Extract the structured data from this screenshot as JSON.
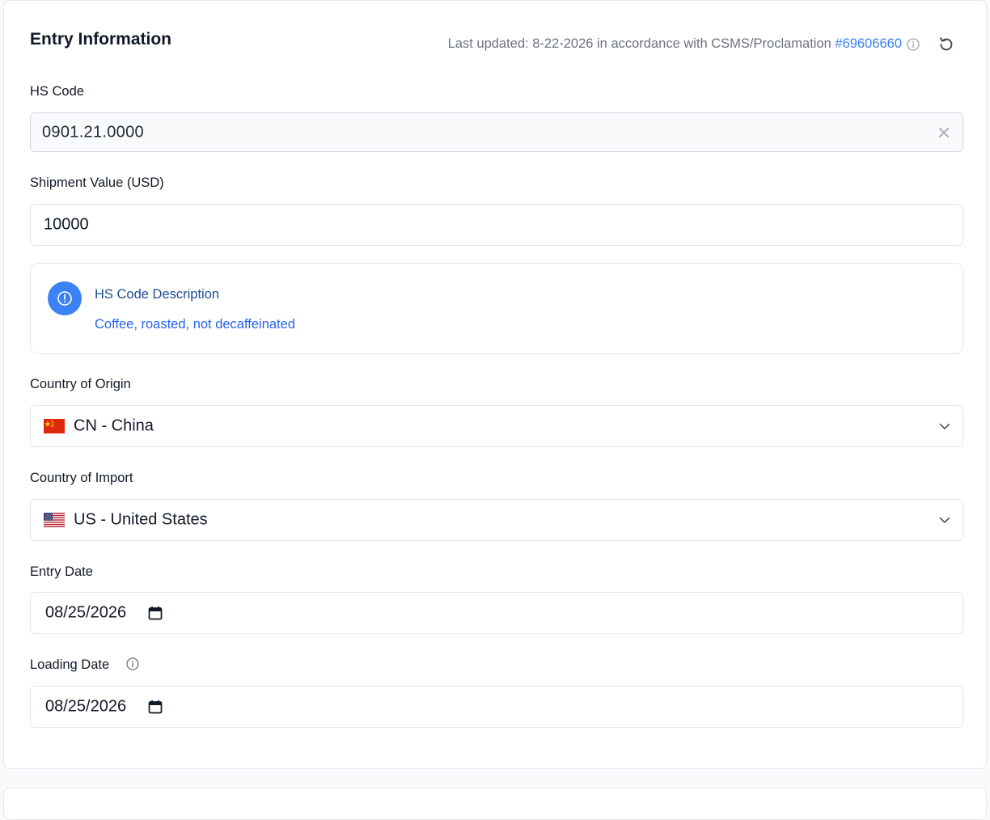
{
  "header": {
    "title": "Entry Information",
    "updated_prefix": "Last updated: 8-22-2026 in accordance with CSMS/Proclamation ",
    "proclamation_link": "#69606660",
    "info_icon": "info-icon",
    "refresh_icon": "refresh-icon"
  },
  "hs_code": {
    "label": "HS Code",
    "value": "0901.21.0000",
    "clear_icon": "close-icon"
  },
  "shipment_value": {
    "label": "Shipment Value (USD)",
    "value": "10000"
  },
  "notice": {
    "icon": "alert-circle-icon",
    "title": "HS Code Description",
    "description": "Coffee, roasted, not decaffeinated"
  },
  "country_of_origin": {
    "label": "Country of Origin",
    "selected": "CN - China",
    "flag_icon": "china-flag-icon"
  },
  "country_of_import": {
    "label": "Country of Import",
    "selected": "US - United States",
    "flag_icon": "us-flag-icon"
  },
  "entry_date": {
    "label": "Entry Date",
    "value": "08/25/2026"
  },
  "loading_date": {
    "label": "Loading Date",
    "value": "08/25/2026",
    "info_icon": "info-icon"
  },
  "colors": {
    "accent": "#3b82f6",
    "notice_title": "#1e4d8f",
    "muted_text": "#6b7280",
    "border": "#e5e7eb"
  }
}
